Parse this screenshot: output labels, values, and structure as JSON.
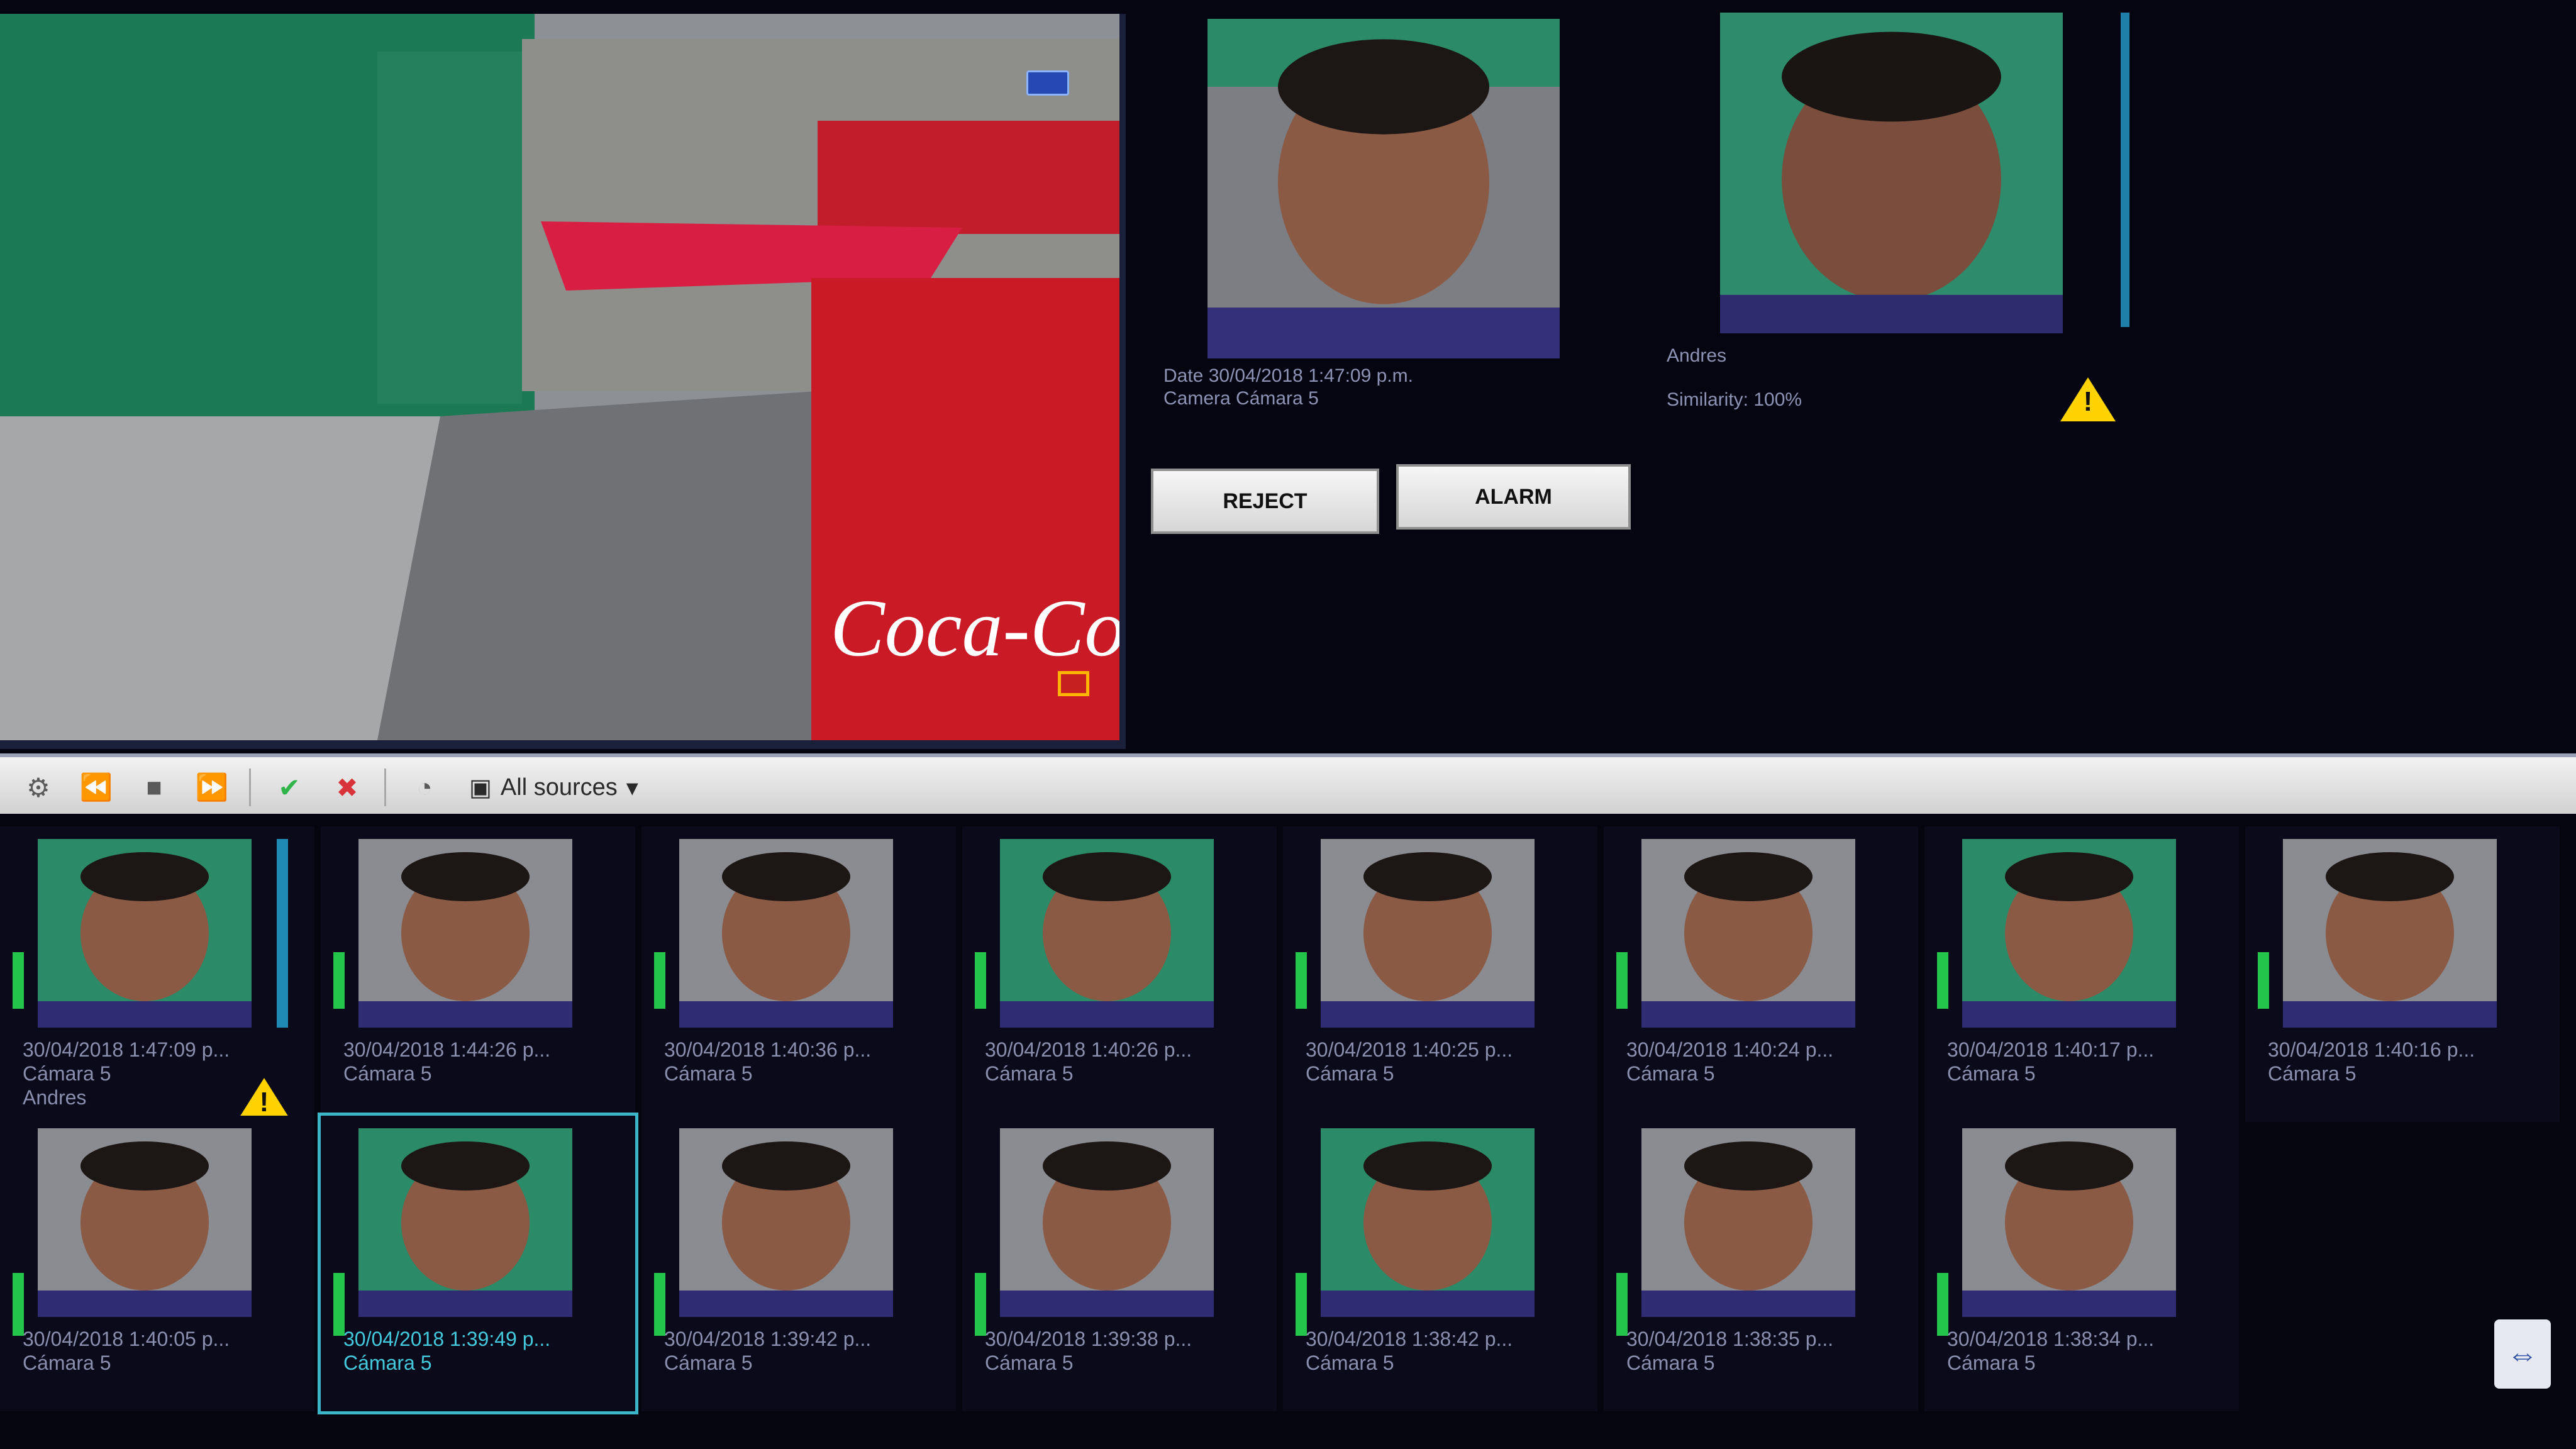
{
  "alarm": {
    "date_line": "Date 30/04/2018 1:47:09 p.m.",
    "camera_line": "Camera Cámara 5",
    "match_name": "Andres",
    "similarity_line": "Similarity: 100%",
    "reject_label": "REJECT",
    "alarm_label": "ALARM"
  },
  "toolbar": {
    "source_label": "All sources"
  },
  "events": [
    {
      "time": "30/04/2018 1:47:09 p...",
      "camera": "Cámara 5",
      "name": "Andres",
      "alert": true
    },
    {
      "time": "30/04/2018 1:44:26 p...",
      "camera": "Cámara 5"
    },
    {
      "time": "30/04/2018 1:40:36 p...",
      "camera": "Cámara 5"
    },
    {
      "time": "30/04/2018 1:40:26 p...",
      "camera": "Cámara 5"
    },
    {
      "time": "30/04/2018 1:40:25 p...",
      "camera": "Cámara 5"
    },
    {
      "time": "30/04/2018 1:40:24 p...",
      "camera": "Cámara 5"
    },
    {
      "time": "30/04/2018 1:40:17 p...",
      "camera": "Cámara 5"
    },
    {
      "time": "30/04/2018 1:40:16 p...",
      "camera": "Cámara 5"
    },
    {
      "time": "30/04/2018 1:40:05 p...",
      "camera": "Cámara 5"
    },
    {
      "time": "30/04/2018 1:39:49 p...",
      "camera": "Cámara 5",
      "selected": true
    },
    {
      "time": "30/04/2018 1:39:42 p...",
      "camera": "Cámara 5"
    },
    {
      "time": "30/04/2018 1:39:38 p...",
      "camera": "Cámara 5"
    },
    {
      "time": "30/04/2018 1:38:42 p...",
      "camera": "Cámara 5"
    },
    {
      "time": "30/04/2018 1:38:35 p...",
      "camera": "Cámara 5"
    },
    {
      "time": "30/04/2018 1:38:34 p...",
      "camera": "Cámara 5"
    }
  ],
  "colors": {
    "alert": "#ffd200",
    "selection": "#3bb6c9",
    "level": "#23c64a"
  }
}
